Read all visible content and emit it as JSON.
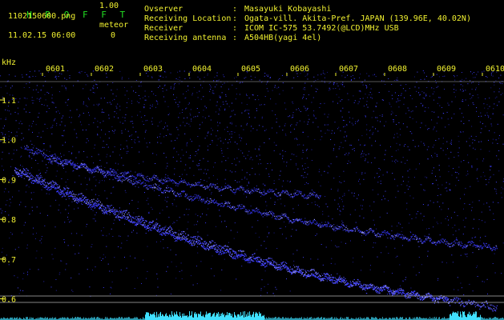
{
  "header": {
    "app_title": "H R O F F T",
    "app_version": "1.00",
    "filename": "1102150600.png",
    "datetime": "11.02.15 06:00",
    "meteor_label": "meteor",
    "meteor_count": "0"
  },
  "info": [
    {
      "key": "Ovserver",
      "value": "Masayuki Kobayashi"
    },
    {
      "key": "Receiving Location",
      "value": "Ogata-vill. Akita-Pref. JAPAN (139.96E, 40.02N)"
    },
    {
      "key": "Receiver",
      "value": "ICOM IC-575 53.7492(@LCD)MHz USB"
    },
    {
      "key": "Receiving antenna",
      "value": "A504HB(yagi 4el)"
    }
  ],
  "info_separator": ":",
  "axis": {
    "y_unit": "kHz",
    "y_ticks": [
      "1.1",
      "1.0",
      "0.9",
      "0.8",
      "0.7",
      "0.6"
    ],
    "y_values": [
      1.1,
      1.0,
      0.9,
      0.8,
      0.7,
      0.6
    ],
    "x_ticks": [
      "0601",
      "0602",
      "0603",
      "0604",
      "0605",
      "0606",
      "0607",
      "0608",
      "0609",
      "0610"
    ]
  },
  "colors": {
    "background": "#000000",
    "label_green": "#22e022",
    "label_yellow": "#f0f030",
    "noise_blue": "#3a3aff",
    "signal_cyan": "#40e0ff",
    "reference_line": "#b0b0b0"
  }
}
